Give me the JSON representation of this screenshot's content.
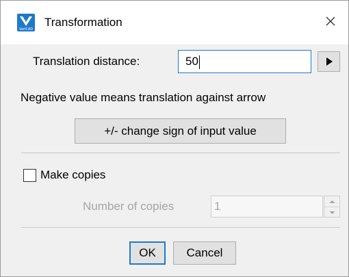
{
  "window": {
    "title": "Transformation",
    "logo_text": "VariCAD",
    "close_glyph": "✕"
  },
  "translation": {
    "label": "Translation distance:",
    "value": "50"
  },
  "hint": "Negative value means translation against arrow",
  "change_sign_label": "+/- change sign of input value",
  "make_copies": {
    "label": "Make copies",
    "checked": false
  },
  "number_of_copies": {
    "label": "Number of copies",
    "value": "1",
    "enabled": false
  },
  "buttons": {
    "ok": "OK",
    "cancel": "Cancel"
  },
  "colors": {
    "accent": "#1f79c9",
    "dialog_bg": "#f0f0f0",
    "disabled_text": "#a5a5a5"
  },
  "icons": {
    "app": "varicad-logo-icon",
    "close": "close-icon",
    "arrow": "play-arrow-icon",
    "spin_up": "chevron-up-icon",
    "spin_down": "chevron-down-icon"
  }
}
